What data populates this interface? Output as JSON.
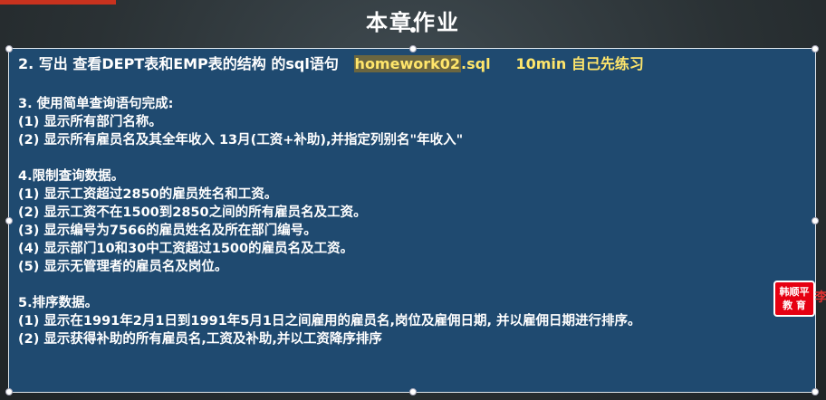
{
  "title": "本章作业",
  "homework": {
    "task_prefix": "2. 写出 查看DEPT表和EMP表的结构 的sql语句",
    "filename_highlight": "homework02",
    "filename_ext": ".sql",
    "time_note": "10min 自己先练习"
  },
  "sections": [
    {
      "heading": "3. 使用简单查询语句完成:",
      "items": [
        "(1) 显示所有部门名称。",
        "(2) 显示所有雇员名及其全年收入 13月(工资+补助),并指定列别名\"年收入\""
      ]
    },
    {
      "heading": "4.限制查询数据。",
      "items": [
        "(1) 显示工资超过2850的雇员姓名和工资。",
        "(2) 显示工资不在1500到2850之间的所有雇员名及工资。",
        "(3) 显示编号为7566的雇员姓名及所在部门编号。",
        "(4) 显示部门10和30中工资超过1500的雇员名及工资。",
        "(5) 显示无管理者的雇员名及岗位。"
      ]
    },
    {
      "heading": "5.排序数据。",
      "items": [
        "(1) 显示在1991年2月1日到1991年5月1日之间雇用的雇员名,岗位及雇佣日期, 并以雇佣日期进行排序。",
        "(2) 显示获得补助的所有雇员名,工资及补助,并以工资降序排序"
      ]
    }
  ],
  "badge": {
    "line1": "韩顺平",
    "line2": "教 育",
    "edge_text": "李"
  },
  "colors": {
    "panel_bg": "#1f4a70",
    "highlight_text": "#ffe66b",
    "badge_red": "#e60012"
  }
}
